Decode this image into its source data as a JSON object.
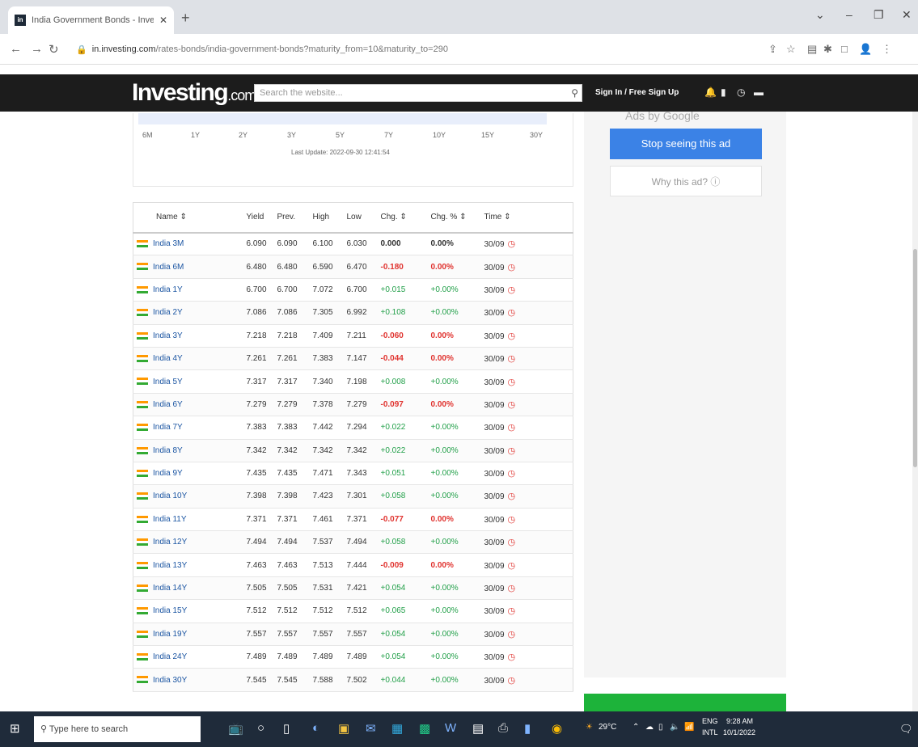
{
  "browser": {
    "tab_title": "India Government Bonds - Inves",
    "favicon": "in",
    "url_domain": "in.investing.com",
    "url_path": "/rates-bonds/india-government-bonds?maturity_from=10&maturity_to=290"
  },
  "site": {
    "logo_main": "Investing",
    "logo_suffix": ".com",
    "search_placeholder": "Search the website...",
    "signin": "Sign In / Free Sign Up"
  },
  "chart_strip": {
    "ticks": [
      "6M",
      "1Y",
      "2Y",
      "3Y",
      "5Y",
      "7Y",
      "10Y",
      "15Y",
      "30Y"
    ],
    "last_update": "Last Update: 2022-09-30 12:41:54"
  },
  "table": {
    "headers": [
      "Name",
      "Yield",
      "Prev.",
      "High",
      "Low",
      "Chg.",
      "Chg. %",
      "Time"
    ],
    "rows": [
      {
        "name": "India 3M",
        "yield": "6.090",
        "prev": "6.090",
        "high": "6.100",
        "low": "6.030",
        "chg": "0.000",
        "chgp": "0.00%",
        "time": "30/09",
        "dir": "zero"
      },
      {
        "name": "India 6M",
        "yield": "6.480",
        "prev": "6.480",
        "high": "6.590",
        "low": "6.470",
        "chg": "-0.180",
        "chgp": "0.00%",
        "time": "30/09",
        "dir": "neg"
      },
      {
        "name": "India 1Y",
        "yield": "6.700",
        "prev": "6.700",
        "high": "7.072",
        "low": "6.700",
        "chg": "+0.015",
        "chgp": "+0.00%",
        "time": "30/09",
        "dir": "pos"
      },
      {
        "name": "India 2Y",
        "yield": "7.086",
        "prev": "7.086",
        "high": "7.305",
        "low": "6.992",
        "chg": "+0.108",
        "chgp": "+0.00%",
        "time": "30/09",
        "dir": "pos"
      },
      {
        "name": "India 3Y",
        "yield": "7.218",
        "prev": "7.218",
        "high": "7.409",
        "low": "7.211",
        "chg": "-0.060",
        "chgp": "0.00%",
        "time": "30/09",
        "dir": "neg"
      },
      {
        "name": "India 4Y",
        "yield": "7.261",
        "prev": "7.261",
        "high": "7.383",
        "low": "7.147",
        "chg": "-0.044",
        "chgp": "0.00%",
        "time": "30/09",
        "dir": "neg"
      },
      {
        "name": "India 5Y",
        "yield": "7.317",
        "prev": "7.317",
        "high": "7.340",
        "low": "7.198",
        "chg": "+0.008",
        "chgp": "+0.00%",
        "time": "30/09",
        "dir": "pos"
      },
      {
        "name": "India 6Y",
        "yield": "7.279",
        "prev": "7.279",
        "high": "7.378",
        "low": "7.279",
        "chg": "-0.097",
        "chgp": "0.00%",
        "time": "30/09",
        "dir": "neg"
      },
      {
        "name": "India 7Y",
        "yield": "7.383",
        "prev": "7.383",
        "high": "7.442",
        "low": "7.294",
        "chg": "+0.022",
        "chgp": "+0.00%",
        "time": "30/09",
        "dir": "pos"
      },
      {
        "name": "India 8Y",
        "yield": "7.342",
        "prev": "7.342",
        "high": "7.342",
        "low": "7.342",
        "chg": "+0.022",
        "chgp": "+0.00%",
        "time": "30/09",
        "dir": "pos"
      },
      {
        "name": "India 9Y",
        "yield": "7.435",
        "prev": "7.435",
        "high": "7.471",
        "low": "7.343",
        "chg": "+0.051",
        "chgp": "+0.00%",
        "time": "30/09",
        "dir": "pos"
      },
      {
        "name": "India 10Y",
        "yield": "7.398",
        "prev": "7.398",
        "high": "7.423",
        "low": "7.301",
        "chg": "+0.058",
        "chgp": "+0.00%",
        "time": "30/09",
        "dir": "pos"
      },
      {
        "name": "India 11Y",
        "yield": "7.371",
        "prev": "7.371",
        "high": "7.461",
        "low": "7.371",
        "chg": "-0.077",
        "chgp": "0.00%",
        "time": "30/09",
        "dir": "neg"
      },
      {
        "name": "India 12Y",
        "yield": "7.494",
        "prev": "7.494",
        "high": "7.537",
        "low": "7.494",
        "chg": "+0.058",
        "chgp": "+0.00%",
        "time": "30/09",
        "dir": "pos"
      },
      {
        "name": "India 13Y",
        "yield": "7.463",
        "prev": "7.463",
        "high": "7.513",
        "low": "7.444",
        "chg": "-0.009",
        "chgp": "0.00%",
        "time": "30/09",
        "dir": "neg"
      },
      {
        "name": "India 14Y",
        "yield": "7.505",
        "prev": "7.505",
        "high": "7.531",
        "low": "7.421",
        "chg": "+0.054",
        "chgp": "+0.00%",
        "time": "30/09",
        "dir": "pos"
      },
      {
        "name": "India 15Y",
        "yield": "7.512",
        "prev": "7.512",
        "high": "7.512",
        "low": "7.512",
        "chg": "+0.065",
        "chgp": "+0.00%",
        "time": "30/09",
        "dir": "pos"
      },
      {
        "name": "India 19Y",
        "yield": "7.557",
        "prev": "7.557",
        "high": "7.557",
        "low": "7.557",
        "chg": "+0.054",
        "chgp": "+0.00%",
        "time": "30/09",
        "dir": "pos"
      },
      {
        "name": "India 24Y",
        "yield": "7.489",
        "prev": "7.489",
        "high": "7.489",
        "low": "7.489",
        "chg": "+0.054",
        "chgp": "+0.00%",
        "time": "30/09",
        "dir": "pos"
      },
      {
        "name": "India 30Y",
        "yield": "7.545",
        "prev": "7.545",
        "high": "7.588",
        "low": "7.502",
        "chg": "+0.044",
        "chgp": "+0.00%",
        "time": "30/09",
        "dir": "pos"
      }
    ]
  },
  "ad": {
    "ads_by": "Ads by Google",
    "stop": "Stop seeing this ad",
    "why": "Why this ad? ⓘ"
  },
  "taskbar": {
    "search": "Type here to search",
    "weather": "29°C",
    "lang1": "ENG",
    "lang2": "INTL",
    "time": "9:28 AM",
    "date": "10/1/2022"
  },
  "colors": {
    "positive": "#23a04a",
    "negative": "#e0332f",
    "link": "#1b55a2",
    "accent": "#3b82e6"
  }
}
